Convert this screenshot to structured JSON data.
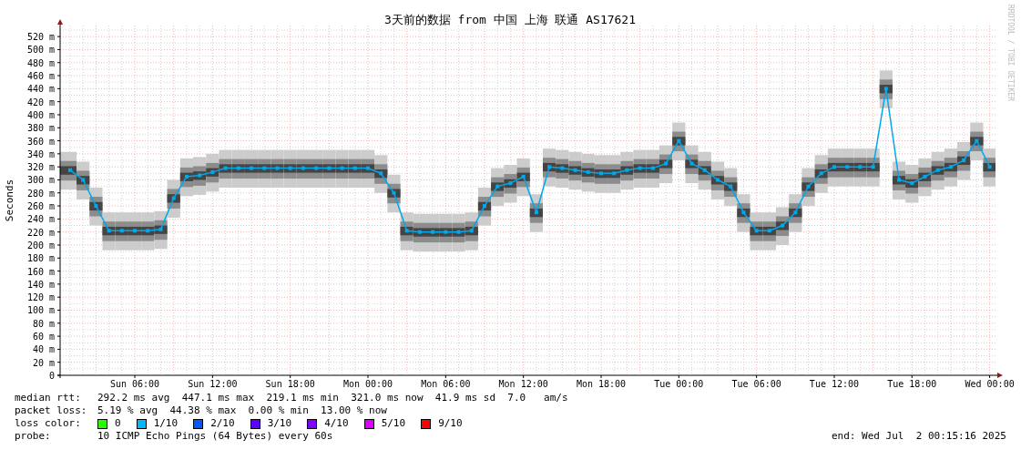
{
  "graph": {
    "credit": "RRDTOOL / TOBI OETIKER",
    "chart_data": {
      "type": "line",
      "grid": true,
      "title": "3天前的数据 from 中国 上海 联通 AS17621",
      "ylabel": "Seconds",
      "categories": [
        null,
        null,
        null,
        null,
        null,
        "Sun 06:00",
        null,
        null,
        null,
        null,
        null,
        "Sun 12:00",
        null,
        null,
        null,
        null,
        null,
        "Sun 18:00",
        null,
        null,
        null,
        null,
        null,
        "Mon 00:00",
        null,
        null,
        null,
        null,
        null,
        "Mon 06:00",
        null,
        null,
        null,
        null,
        null,
        "Mon 12:00",
        null,
        null,
        null,
        null,
        null,
        "Mon 18:00",
        null,
        null,
        null,
        null,
        null,
        "Tue 00:00",
        null,
        null,
        null,
        null,
        null,
        "Tue 06:00",
        null,
        null,
        null,
        null,
        null,
        "Tue 12:00",
        null,
        null,
        null,
        null,
        null,
        "Tue 18:00",
        null,
        null,
        null,
        null,
        null,
        "Wed 00:00"
      ],
      "series": [
        {
          "color": "#00a8ec",
          "marker": "square",
          "values": [
            315,
            300,
            260,
            222,
            222,
            222,
            222,
            224,
            272,
            305,
            307,
            312,
            318,
            318,
            318,
            318,
            318,
            318,
            318,
            318,
            318,
            318,
            318,
            318,
            310,
            280,
            222,
            220,
            220,
            220,
            220,
            222,
            260,
            290,
            295,
            305,
            250,
            320,
            318,
            315,
            312,
            310,
            310,
            315,
            318,
            318,
            325,
            360,
            325,
            315,
            300,
            290,
            250,
            222,
            222,
            230,
            250,
            290,
            310,
            320,
            320,
            320,
            320,
            440,
            300,
            295,
            305,
            315,
            320,
            330,
            360,
            320
          ]
        }
      ],
      "ylim": [
        0,
        537
      ],
      "yticks": [
        {
          "value": 0,
          "label": "0"
        },
        {
          "value": 20,
          "label": "20 m"
        },
        {
          "value": 40,
          "label": "40 m"
        },
        {
          "value": 60,
          "label": "60 m"
        },
        {
          "value": 80,
          "label": "80 m"
        },
        {
          "value": 100,
          "label": "100 m"
        },
        {
          "value": 120,
          "label": "120 m"
        },
        {
          "value": 140,
          "label": "140 m"
        },
        {
          "value": 160,
          "label": "160 m"
        },
        {
          "value": 180,
          "label": "180 m"
        },
        {
          "value": 200,
          "label": "200 m"
        },
        {
          "value": 220,
          "label": "220 m"
        },
        {
          "value": 240,
          "label": "240 m"
        },
        {
          "value": 260,
          "label": "260 m"
        },
        {
          "value": 280,
          "label": "280 m"
        },
        {
          "value": 300,
          "label": "300 m"
        },
        {
          "value": 320,
          "label": "320 m"
        },
        {
          "value": 340,
          "label": "340 m"
        },
        {
          "value": 360,
          "label": "360 m"
        },
        {
          "value": 380,
          "label": "380 m"
        },
        {
          "value": 400,
          "label": "400 m"
        },
        {
          "value": 420,
          "label": "420 m"
        },
        {
          "value": 440,
          "label": "440 m"
        },
        {
          "value": 460,
          "label": "460 m"
        },
        {
          "value": 480,
          "label": "480 m"
        },
        {
          "value": 500,
          "label": "500 m"
        },
        {
          "value": 520,
          "label": "520 m"
        }
      ]
    }
  },
  "legend": {
    "stats": [
      {
        "label": "median rtt:",
        "value": "292.2 ms avg  447.1 ms max  219.1 ms min  321.0 ms now  41.9 ms sd  7.0   am/s"
      },
      {
        "label": "packet loss:",
        "value": "5.19 % avg  44.38 % max  0.00 % min  13.00 % now"
      }
    ],
    "loss_color": {
      "label": "loss color:",
      "items": [
        {
          "label": "0",
          "color": "#26ff00"
        },
        {
          "label": "1/10",
          "color": "#00b8ff"
        },
        {
          "label": "2/10",
          "color": "#0059ff"
        },
        {
          "label": "3/10",
          "color": "#5e00ff"
        },
        {
          "label": "4/10",
          "color": "#7e00ff"
        },
        {
          "label": "5/10",
          "color": "#dd00ff"
        },
        {
          "label": "9/10",
          "color": "#ff0000"
        }
      ]
    },
    "probe": {
      "label": "probe:",
      "value": "10 ICMP Echo Pings (64 Bytes) every 60s"
    },
    "end": "end: Wed Jul  2 00:15:16 2025"
  }
}
